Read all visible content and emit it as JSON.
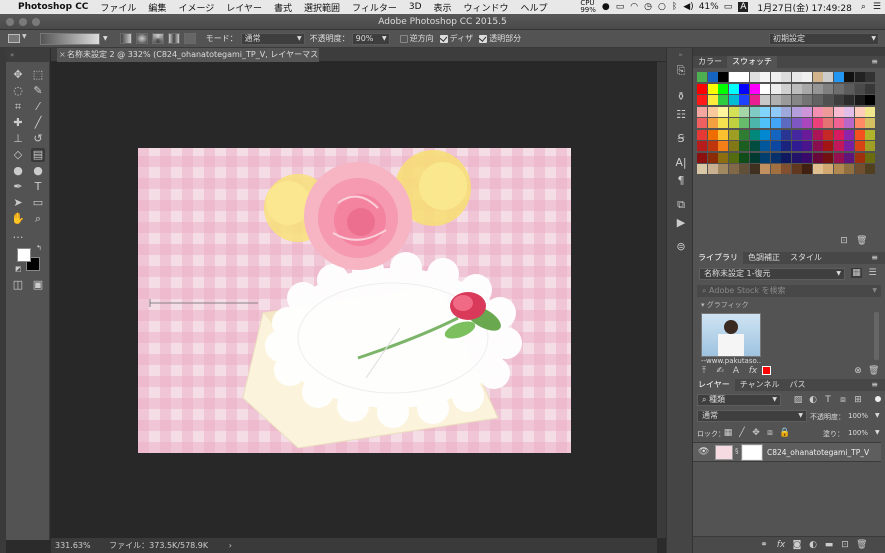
{
  "menubar": {
    "app": "Photoshop CC",
    "items": [
      "ファイル",
      "編集",
      "イメージ",
      "レイヤー",
      "書式",
      "選択範囲",
      "フィルター",
      "3D",
      "表示",
      "ウィンドウ",
      "ヘルプ"
    ],
    "battery_text": "41%",
    "datetime": "1月27日(金) 17:49:28",
    "cpu_label": "99%"
  },
  "window": {
    "title": "Adobe Photoshop CC 2015.5"
  },
  "options": {
    "mode_label": "モード：",
    "mode_value": "通常",
    "opacity_label": "不透明度：",
    "opacity_value": "90%",
    "reverse_label": "逆方向",
    "dither_label": "ディザ",
    "transparency_label": "透明部分",
    "workspace": "初期設定"
  },
  "document": {
    "tab_label": "名称未設定 2 @ 332% (C824_ohanatotegami_TP_V, レイヤーマスク/8) *"
  },
  "status": {
    "zoom": "331.63%",
    "file_info": "ファイル：373.5K/578.9K"
  },
  "color_panel": {
    "tab_color": "カラー",
    "tab_swatches": "スウォッチ",
    "swatch_rows": [
      [
        "#4caf50",
        "#1565c0",
        "#000000",
        "#ffffff",
        "#ffffff",
        "#e0e0e0",
        "#f5f5f5",
        "#eeeeee",
        "#dddddd",
        "#e8e8e8",
        "#f0f0f0",
        "#d2b48c",
        "#cccccc",
        "#2196f3",
        "#111111",
        "#222222",
        "#333333"
      ],
      [
        "#ff0000",
        "#ffff00",
        "#00ff00",
        "#00ffff",
        "#0000ff",
        "#ff00ff",
        "#ffffff",
        "#eeeeee",
        "#d0d0d0",
        "#bdbdbd",
        "#a8a8a8",
        "#969696",
        "#808080",
        "#6e6e6e",
        "#5c5c5c",
        "#4a4a4a",
        "#383838"
      ],
      [
        "#ff1a1a",
        "#ffeb3b",
        "#2ecc40",
        "#00bcd4",
        "#1e40ff",
        "#e91e90",
        "#c8c8c8",
        "#b0b0b0",
        "#9a9a9a",
        "#868686",
        "#747474",
        "#626262",
        "#505050",
        "#3e3e3e",
        "#2c2c2c",
        "#1a1a1a",
        "#000000"
      ],
      [
        "#f4a6a0",
        "#f9c89b",
        "#fff59d",
        "#d4e157",
        "#a5d6a7",
        "#80cbc4",
        "#81d4fa",
        "#90caf9",
        "#9fa8da",
        "#b39ddb",
        "#ce93d8",
        "#f48fb1",
        "#ef9a9a",
        "#f8bbd0",
        "#e1bee7",
        "#ffccbc",
        "#f0e68c"
      ],
      [
        "#f06060",
        "#f5a040",
        "#f5e050",
        "#c0d040",
        "#66bb6a",
        "#4db6ac",
        "#4fc3f7",
        "#42a5f5",
        "#5c6bc0",
        "#7e57c2",
        "#ab47bc",
        "#ec407a",
        "#e57373",
        "#f06292",
        "#ba68c8",
        "#ff8a65",
        "#d4c060"
      ],
      [
        "#e53935",
        "#ef6c00",
        "#fbc02d",
        "#9e9d24",
        "#2e7d32",
        "#00897b",
        "#0288d1",
        "#1565c0",
        "#283593",
        "#4527a0",
        "#6a1b9a",
        "#ad1457",
        "#c62828",
        "#d81b60",
        "#8e24aa",
        "#f4511e",
        "#afb42b"
      ],
      [
        "#b71c1c",
        "#bf360c",
        "#f57f17",
        "#827717",
        "#1b5e20",
        "#004d40",
        "#01579b",
        "#0d47a1",
        "#1a237e",
        "#311b92",
        "#4a148c",
        "#880e4f",
        "#a31515",
        "#c2185b",
        "#7b1fa2",
        "#d84315",
        "#9e9d24"
      ],
      [
        "#8b1010",
        "#8a2c08",
        "#8d6e10",
        "#556b10",
        "#114d18",
        "#00392f",
        "#013f6e",
        "#08306b",
        "#101860",
        "#221268",
        "#3a0a6a",
        "#66083a",
        "#701010",
        "#941050",
        "#5e167a",
        "#9e3010",
        "#6b6b10"
      ],
      [
        "#d8c8a8",
        "#c8b090",
        "#a08860",
        "#806848",
        "#605038",
        "#403020",
        "#c09060",
        "#a07040",
        "#805030",
        "#603820",
        "#402010",
        "#e0c090",
        "#d0a870",
        "#b08850",
        "#907040",
        "#705030",
        "#504020"
      ]
    ]
  },
  "library_panel": {
    "tab_libraries": "ライブラリ",
    "tab_adjust": "色調補正",
    "tab_styles": "スタイル",
    "library_select": "名称未設定 1-復元",
    "search_placeholder": "Adobe Stock を検索",
    "group_label": "グラフィック",
    "thumb_caption": "--www.pakutaso...."
  },
  "layers_panel": {
    "tab_layers": "レイヤー",
    "tab_channels": "チャンネル",
    "tab_paths": "パス",
    "filter_label": "種類",
    "blend_mode": "通常",
    "opacity_label": "不透明度：",
    "opacity_value": "100%",
    "lock_label": "ロック：",
    "fill_label": "塗り：",
    "fill_value": "100%",
    "layer_name": "C824_ohanatotegami_TP_V"
  },
  "colors": {
    "foreground": "#ffffff",
    "background": "#000000",
    "swatch_highlight": "#ff0000"
  }
}
